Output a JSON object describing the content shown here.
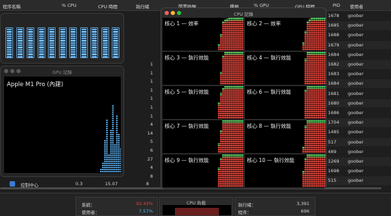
{
  "columns": {
    "process_name": "程序名稱",
    "cpu_pct": "% CPU",
    "cpu_time": "CPU 時間",
    "threads": "執行緒",
    "idle_wake": "閒置喚醒",
    "kind": "種類",
    "gpu_pct": "% GPU",
    "gpu_time": "GPU 時間",
    "pid": "PID",
    "user": "使用者"
  },
  "right_rows": [
    {
      "pid": "1678",
      "user": "goober"
    },
    {
      "pid": "1685",
      "user": "goober"
    },
    {
      "pid": "1688",
      "user": "goober"
    },
    {
      "pid": "1679",
      "user": "goober"
    },
    {
      "pid": "1684",
      "user": "goober"
    },
    {
      "pid": "1682",
      "user": "goober"
    },
    {
      "pid": "1683",
      "user": "goober"
    },
    {
      "pid": "1684",
      "user": "goober"
    },
    {
      "pid": "1681",
      "user": "goober"
    },
    {
      "pid": "1680",
      "user": "goober"
    },
    {
      "pid": "1686",
      "user": "goober"
    },
    {
      "pid": "1704",
      "user": "goober"
    },
    {
      "pid": "1485",
      "user": "goober"
    },
    {
      "pid": "517",
      "user": "goober"
    },
    {
      "pid": "489",
      "user": "goober"
    },
    {
      "pid": "1269",
      "user": "goober"
    },
    {
      "pid": "1698",
      "user": "goober"
    },
    {
      "pid": "515",
      "user": "goober"
    }
  ],
  "threads_values": [
    "1",
    "1",
    "1",
    "1",
    "1",
    "1",
    "1",
    "4",
    "14",
    "5",
    "6",
    "27",
    "4",
    "8"
  ],
  "bottom_row": {
    "name": "控制中心",
    "cpu": "0.3",
    "time": "15.07",
    "threads": "8"
  },
  "gpu_window": {
    "title": "GPU 記錄",
    "gpu_name": "Apple M1 Pro (內建)"
  },
  "gpu_levels": [
    0.05,
    0.1,
    0.35,
    0.55,
    0.2,
    0.45,
    0.7,
    0.3,
    0.6,
    0.4,
    0.25,
    0.5,
    0.15,
    0.3,
    0.1,
    0.05,
    0.02
  ],
  "gpu_meter_levels": [
    1,
    1,
    1,
    1,
    1,
    1,
    1,
    1,
    1,
    1,
    1
  ],
  "cpu_window": {
    "title": "CPU 記錄"
  },
  "cores": [
    {
      "label": "核心 1 — 效率",
      "history": [
        0,
        0,
        0,
        0,
        0,
        0,
        0,
        0,
        0,
        0,
        0,
        0,
        0,
        0,
        0,
        0,
        0,
        0,
        0,
        0,
        0,
        0,
        0,
        0,
        0,
        0,
        0.2,
        0.5,
        0.9,
        0.95,
        0.98,
        1,
        1,
        1,
        1,
        1,
        1,
        1
      ]
    },
    {
      "label": "核心 2 — 效率",
      "history": [
        0,
        0,
        0,
        0,
        0,
        0,
        0,
        0,
        0,
        0,
        0,
        0,
        0,
        0,
        0,
        0,
        0,
        0,
        0,
        0,
        0,
        0,
        0,
        0,
        0,
        0,
        0,
        0.25,
        0.6,
        0.9,
        0.97,
        1,
        1,
        1,
        1,
        1,
        1,
        1
      ]
    },
    {
      "label": "核心 3 — 執行效能",
      "history": [
        0,
        0,
        0,
        0,
        0,
        0,
        0,
        0,
        0,
        0,
        0,
        0,
        0,
        0,
        0,
        0,
        0,
        0,
        0,
        0,
        0,
        0,
        0,
        0,
        0,
        0,
        0,
        0.4,
        0.9,
        1,
        1,
        1,
        1,
        1,
        1,
        1,
        1,
        1
      ]
    },
    {
      "label": "核心 4 — 執行效能",
      "history": [
        0,
        0,
        0,
        0,
        0,
        0,
        0,
        0,
        0,
        0,
        0,
        0,
        0,
        0,
        0,
        0,
        0,
        0,
        0,
        0,
        0,
        0,
        0,
        0,
        0,
        0,
        0,
        0,
        0.8,
        1,
        1,
        1,
        1,
        1,
        1,
        1,
        1,
        1
      ]
    },
    {
      "label": "核心 5 — 執行效能",
      "history": [
        0,
        0,
        0,
        0,
        0,
        0,
        0,
        0,
        0,
        0,
        0,
        0,
        0,
        0,
        0,
        0,
        0,
        0,
        0,
        0,
        0,
        0,
        0,
        0,
        0,
        0,
        0.5,
        0.8,
        0.95,
        1,
        1,
        1,
        1,
        1,
        1,
        1,
        1,
        1
      ]
    },
    {
      "label": "核心 6 — 執行效能",
      "history": [
        0,
        0,
        0,
        0,
        0,
        0,
        0,
        0,
        0,
        0,
        0,
        0,
        0,
        0,
        0,
        0,
        0,
        0,
        0,
        0,
        0,
        0,
        0,
        0,
        0,
        0,
        0,
        0,
        0.9,
        1,
        1,
        1,
        1,
        1,
        1,
        1,
        1,
        1
      ]
    },
    {
      "label": "核心 7 — 執行效能",
      "history": [
        0,
        0,
        0,
        0,
        0,
        0,
        0,
        0,
        0,
        0,
        0,
        0,
        0,
        0,
        0,
        0,
        0,
        0,
        0,
        0,
        0,
        0,
        0,
        0,
        0,
        0,
        0.3,
        0.7,
        1,
        1,
        1,
        1,
        1,
        1,
        1,
        1,
        1,
        1
      ]
    },
    {
      "label": "核心 8 — 執行效能",
      "history": [
        0,
        0,
        0,
        0,
        0,
        0,
        0,
        0,
        0,
        0,
        0,
        0,
        0,
        0,
        0,
        0,
        0,
        0,
        0,
        0,
        0,
        0,
        0,
        0,
        0,
        0,
        0,
        0.2,
        0.85,
        1,
        1,
        1,
        1,
        1,
        1,
        1,
        1,
        1
      ]
    },
    {
      "label": "核心 9 — 執行效能",
      "history": [
        0,
        0,
        0,
        0,
        0,
        0,
        0,
        0,
        0,
        0,
        0,
        0,
        0,
        0,
        0,
        0,
        0,
        0,
        0,
        0,
        0,
        0,
        0,
        0,
        0,
        0,
        0.6,
        0.9,
        1,
        1,
        1,
        1,
        1,
        1,
        1,
        1,
        1,
        1
      ]
    },
    {
      "label": "核心 10 — 執行效能",
      "history": [
        0,
        0,
        0,
        0,
        0,
        0,
        0,
        0,
        0,
        0,
        0,
        0,
        0,
        0,
        0,
        0,
        0,
        0,
        0,
        0,
        0,
        0,
        0,
        0,
        0,
        0,
        0,
        0.5,
        0.9,
        1,
        1,
        1,
        1,
        1,
        1,
        1,
        1,
        1
      ]
    }
  ],
  "colors": {
    "system": "#e0443a",
    "user": "#4fd161",
    "gpu": "#5aa9e6"
  },
  "summary": {
    "system_label": "系統：",
    "system_value": "92.43%",
    "user_label": "使用者：",
    "user_value": "7.57%",
    "load_title": "CPU 負載",
    "threads_label": "執行緒：",
    "threads_value": "3,391",
    "processes_label": "程序：",
    "processes_value": "696"
  }
}
